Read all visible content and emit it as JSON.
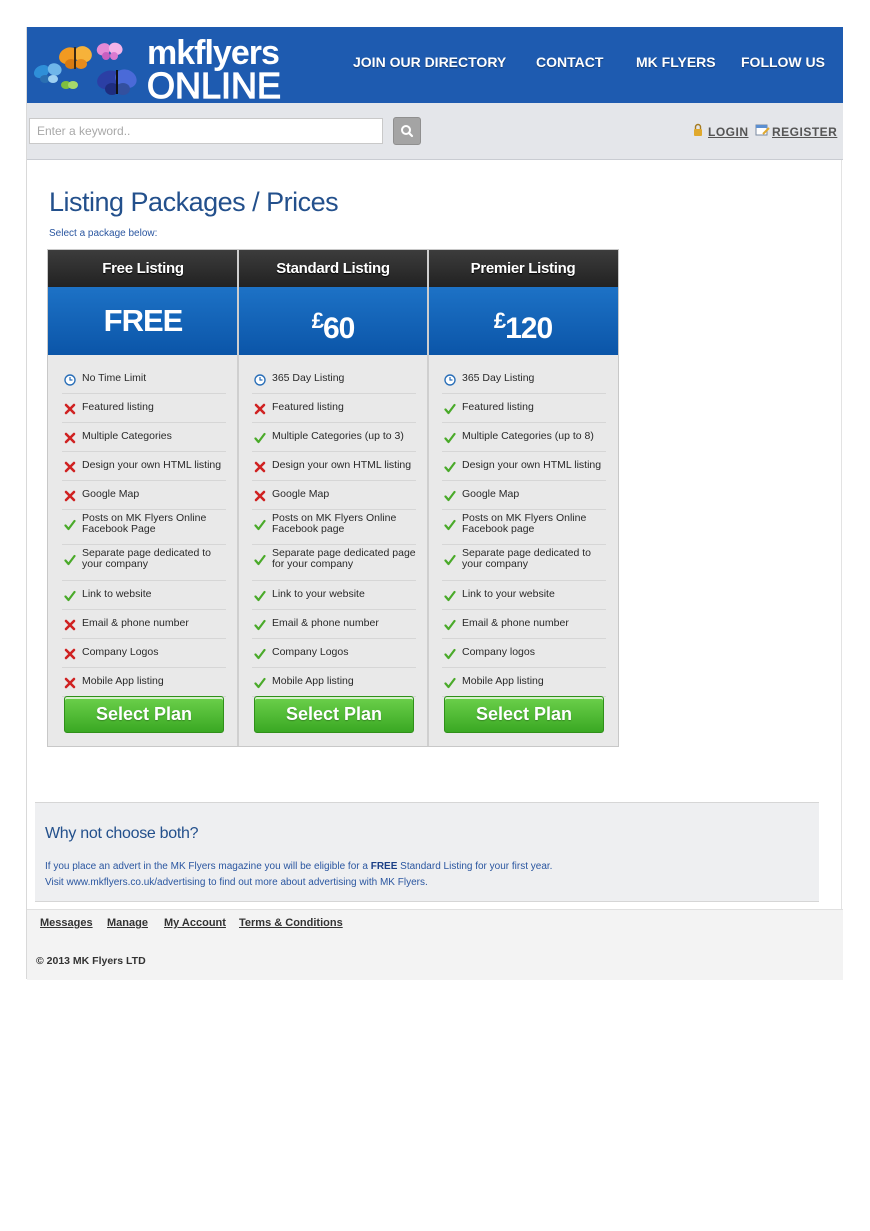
{
  "header": {
    "logo_line1": "mkflyers",
    "logo_line2": "ONLINE",
    "nav": [
      "JOIN OUR DIRECTORY",
      "CONTACT",
      "MK FLYERS",
      "FOLLOW US"
    ]
  },
  "search": {
    "placeholder": "Enter a keyword..",
    "login_label": "LOGIN",
    "register_label": "REGISTER"
  },
  "page": {
    "title": "Listing Packages / Prices",
    "subtitle": "Select a package below:"
  },
  "packages": [
    {
      "name": "Free Listing",
      "price": "FREE",
      "currency": "",
      "features": [
        {
          "icon": "clock-icon",
          "text": "No Time Limit"
        },
        {
          "icon": "cross-icon",
          "text": "Featured listing"
        },
        {
          "icon": "cross-icon",
          "text": "Multiple Categories"
        },
        {
          "icon": "cross-icon",
          "text": "Design your own HTML listing"
        },
        {
          "icon": "cross-icon",
          "text": "Google Map"
        },
        {
          "icon": "check-icon",
          "text": "Posts on MK Flyers Online Facebook Page"
        },
        {
          "icon": "check-icon",
          "text": "Separate page dedicated to your company"
        },
        {
          "icon": "check-icon",
          "text": "Link to website"
        },
        {
          "icon": "cross-icon",
          "text": "Email & phone number"
        },
        {
          "icon": "cross-icon",
          "text": "Company Logos"
        },
        {
          "icon": "cross-icon",
          "text": "Mobile App listing"
        }
      ],
      "button": "Select Plan"
    },
    {
      "name": "Standard Listing",
      "price": "60",
      "currency": "£",
      "features": [
        {
          "icon": "clock-icon",
          "text": "365 Day Listing"
        },
        {
          "icon": "cross-icon",
          "text": "Featured listing"
        },
        {
          "icon": "check-icon",
          "text": "Multiple Categories (up to 3)"
        },
        {
          "icon": "cross-icon",
          "text": "Design your own HTML listing"
        },
        {
          "icon": "cross-icon",
          "text": "Google Map"
        },
        {
          "icon": "check-icon",
          "text": "Posts on MK Flyers Online Facebook page"
        },
        {
          "icon": "check-icon",
          "text": "Separate page dedicated page for your company"
        },
        {
          "icon": "check-icon",
          "text": "Link to your website"
        },
        {
          "icon": "check-icon",
          "text": "Email & phone number"
        },
        {
          "icon": "check-icon",
          "text": "Company Logos"
        },
        {
          "icon": "check-icon",
          "text": "Mobile App listing"
        }
      ],
      "button": "Select Plan"
    },
    {
      "name": "Premier Listing",
      "price": "120",
      "currency": "£",
      "features": [
        {
          "icon": "clock-icon",
          "text": "365 Day Listing"
        },
        {
          "icon": "check-icon",
          "text": "Featured listing"
        },
        {
          "icon": "check-icon",
          "text": "Multiple Categories (up to 8)"
        },
        {
          "icon": "check-icon",
          "text": "Design your own HTML listing"
        },
        {
          "icon": "check-icon",
          "text": "Google Map"
        },
        {
          "icon": "check-icon",
          "text": "Posts on MK Flyers Online Facebook page"
        },
        {
          "icon": "check-icon",
          "text": "Separate page dedicated to your company"
        },
        {
          "icon": "check-icon",
          "text": "Link to your website"
        },
        {
          "icon": "check-icon",
          "text": "Email & phone number"
        },
        {
          "icon": "check-icon",
          "text": "Company logos"
        },
        {
          "icon": "check-icon",
          "text": "Mobile App listing"
        }
      ],
      "button": "Select Plan"
    }
  ],
  "both": {
    "title": "Why not choose both?",
    "line1_pre": "If you place an advert in the MK Flyers magazine you will be eligible for a ",
    "line1_bold": "FREE",
    "line1_post": " Standard Listing for your first year.",
    "line2": "Visit www.mkflyers.co.uk/advertising to find out more about advertising with MK Flyers."
  },
  "footer": {
    "links": [
      "Messages",
      "Manage",
      "My Account",
      "Terms & Conditions"
    ],
    "copyright": "© 2013 MK Flyers LTD"
  },
  "colors": {
    "header_blue": "#1e5bb0",
    "price_blue": "#0b55a8",
    "button_green": "#3aa823",
    "title_blue": "#23508c"
  }
}
